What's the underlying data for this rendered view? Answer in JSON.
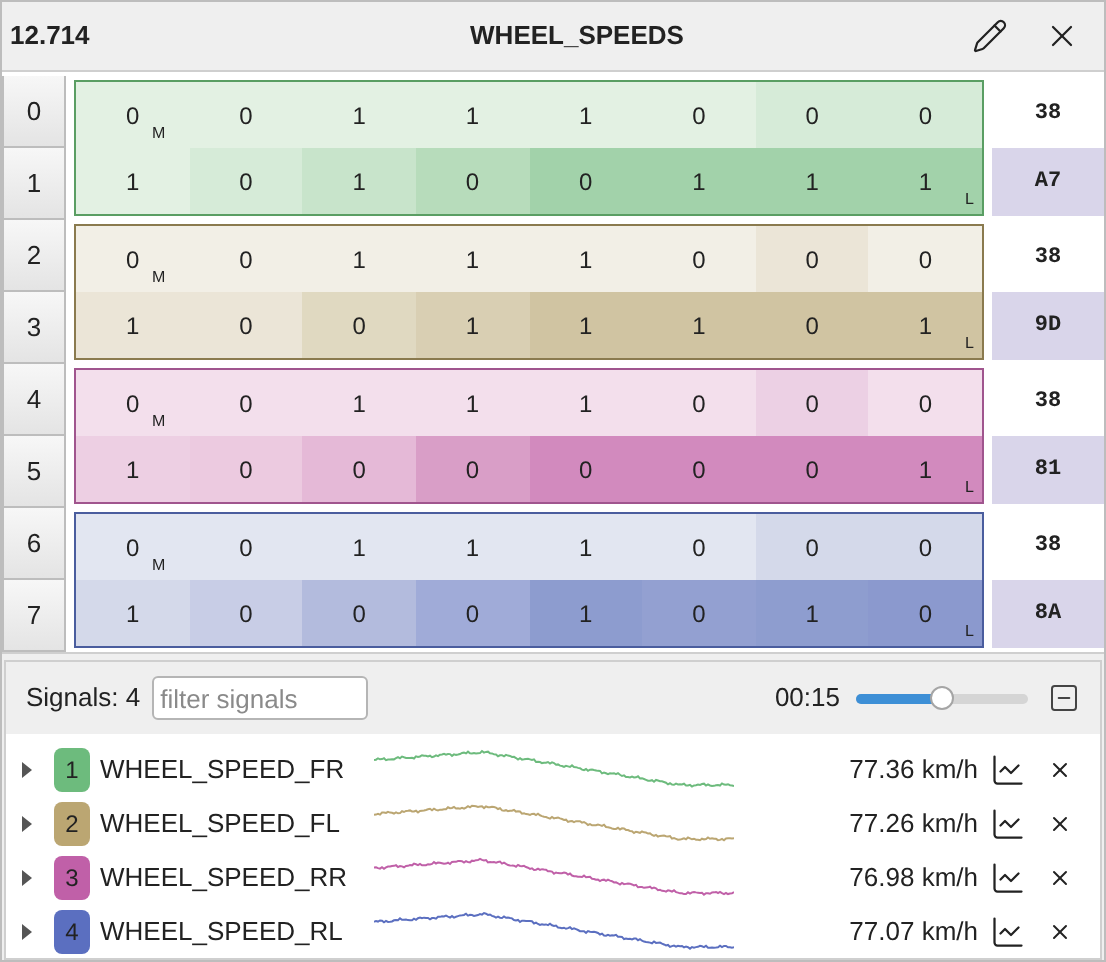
{
  "header": {
    "time": "12.714",
    "title": "WHEEL_SPEEDS"
  },
  "groups": [
    {
      "color": "#5a9e63",
      "rows": [
        {
          "index": "0",
          "hex": "38",
          "hex_highlighted": false,
          "cells": [
            {
              "bit": "0",
              "color": "#e3f1e3",
              "marker": "M"
            },
            {
              "bit": "0",
              "color": "#e3f1e3"
            },
            {
              "bit": "1",
              "color": "#e3f1e3"
            },
            {
              "bit": "1",
              "color": "#e3f1e3"
            },
            {
              "bit": "1",
              "color": "#e3f1e3"
            },
            {
              "bit": "0",
              "color": "#e3f1e3"
            },
            {
              "bit": "0",
              "color": "#d6ebd8"
            },
            {
              "bit": "0",
              "color": "#d6ebd8"
            }
          ]
        },
        {
          "index": "1",
          "hex": "A7",
          "hex_highlighted": true,
          "cells": [
            {
              "bit": "1",
              "color": "#e3f1e3"
            },
            {
              "bit": "0",
              "color": "#d6ebd8"
            },
            {
              "bit": "1",
              "color": "#c8e4cb"
            },
            {
              "bit": "0",
              "color": "#b7dcbb"
            },
            {
              "bit": "0",
              "color": "#a2d2aa"
            },
            {
              "bit": "1",
              "color": "#a2d2aa"
            },
            {
              "bit": "1",
              "color": "#a2d2aa"
            },
            {
              "bit": "1",
              "color": "#a2d2aa",
              "marker": "L"
            }
          ]
        }
      ]
    },
    {
      "color": "#8a7a4e",
      "rows": [
        {
          "index": "2",
          "hex": "38",
          "hex_highlighted": false,
          "cells": [
            {
              "bit": "0",
              "color": "#f2efe6",
              "marker": "M"
            },
            {
              "bit": "0",
              "color": "#f2efe6"
            },
            {
              "bit": "1",
              "color": "#f2efe6"
            },
            {
              "bit": "1",
              "color": "#f2efe6"
            },
            {
              "bit": "1",
              "color": "#f2efe6"
            },
            {
              "bit": "0",
              "color": "#f2efe6"
            },
            {
              "bit": "0",
              "color": "#ebe5d7"
            },
            {
              "bit": "0",
              "color": "#f2efe6"
            }
          ]
        },
        {
          "index": "3",
          "hex": "9D",
          "hex_highlighted": true,
          "cells": [
            {
              "bit": "1",
              "color": "#ebe5d7"
            },
            {
              "bit": "0",
              "color": "#ebe5d7"
            },
            {
              "bit": "0",
              "color": "#e0d9c1"
            },
            {
              "bit": "1",
              "color": "#d9cfb3"
            },
            {
              "bit": "1",
              "color": "#d0c4a2"
            },
            {
              "bit": "1",
              "color": "#d0c4a2"
            },
            {
              "bit": "0",
              "color": "#d0c4a2"
            },
            {
              "bit": "1",
              "color": "#d0c4a2",
              "marker": "L"
            }
          ]
        }
      ]
    },
    {
      "color": "#a0558e",
      "rows": [
        {
          "index": "4",
          "hex": "38",
          "hex_highlighted": false,
          "cells": [
            {
              "bit": "0",
              "color": "#f3dfec",
              "marker": "M"
            },
            {
              "bit": "0",
              "color": "#f3dfec"
            },
            {
              "bit": "1",
              "color": "#f3dfec"
            },
            {
              "bit": "1",
              "color": "#f3dfec"
            },
            {
              "bit": "1",
              "color": "#f3dfec"
            },
            {
              "bit": "0",
              "color": "#f3dfec"
            },
            {
              "bit": "0",
              "color": "#ecd0e4"
            },
            {
              "bit": "0",
              "color": "#f3dfec"
            }
          ]
        },
        {
          "index": "5",
          "hex": "81",
          "hex_highlighted": true,
          "cells": [
            {
              "bit": "1",
              "color": "#edcfe3"
            },
            {
              "bit": "0",
              "color": "#eccae0"
            },
            {
              "bit": "0",
              "color": "#e5b9d7"
            },
            {
              "bit": "0",
              "color": "#d99ec7"
            },
            {
              "bit": "0",
              "color": "#d28abe"
            },
            {
              "bit": "0",
              "color": "#d28abe"
            },
            {
              "bit": "0",
              "color": "#d28abe"
            },
            {
              "bit": "1",
              "color": "#d28abe",
              "marker": "L"
            }
          ]
        }
      ]
    },
    {
      "color": "#4a5d9e",
      "rows": [
        {
          "index": "6",
          "hex": "38",
          "hex_highlighted": false,
          "cells": [
            {
              "bit": "0",
              "color": "#e2e6f1",
              "marker": "M"
            },
            {
              "bit": "0",
              "color": "#e2e6f1"
            },
            {
              "bit": "1",
              "color": "#e2e6f1"
            },
            {
              "bit": "1",
              "color": "#e2e6f1"
            },
            {
              "bit": "1",
              "color": "#e2e6f1"
            },
            {
              "bit": "0",
              "color": "#e2e6f1"
            },
            {
              "bit": "0",
              "color": "#d4d9ea"
            },
            {
              "bit": "0",
              "color": "#d4d9ea"
            }
          ]
        },
        {
          "index": "7",
          "hex": "8A",
          "hex_highlighted": true,
          "cells": [
            {
              "bit": "1",
              "color": "#d4d9ea"
            },
            {
              "bit": "0",
              "color": "#c8cde6"
            },
            {
              "bit": "0",
              "color": "#b3bbdd"
            },
            {
              "bit": "0",
              "color": "#a0abd8"
            },
            {
              "bit": "1",
              "color": "#8d9ccf"
            },
            {
              "bit": "0",
              "color": "#93a0d1"
            },
            {
              "bit": "1",
              "color": "#8e9dcf"
            },
            {
              "bit": "0",
              "color": "#8b99ce",
              "marker": "L"
            }
          ]
        }
      ]
    }
  ],
  "toolbar": {
    "signals_label": "Signals: 4",
    "filter": {
      "placeholder": "filter signals"
    },
    "time": "00:15",
    "slider": {
      "level": 0.5
    }
  },
  "signals": [
    {
      "number": "1",
      "name": "WHEEL_SPEED_FR",
      "value": "77.36 km/h",
      "color": "#6dbb7d",
      "expanded": false
    },
    {
      "number": "2",
      "name": "WHEEL_SPEED_FL",
      "value": "77.26 km/h",
      "color": "#bba672",
      "expanded": false
    },
    {
      "number": "3",
      "name": "WHEEL_SPEED_RR",
      "value": "76.98 km/h",
      "color": "#c060a8",
      "expanded": false
    },
    {
      "number": "4",
      "name": "WHEEL_SPEED_RL",
      "value": "77.07 km/h",
      "color": "#5b6fc0",
      "expanded": false
    }
  ]
}
